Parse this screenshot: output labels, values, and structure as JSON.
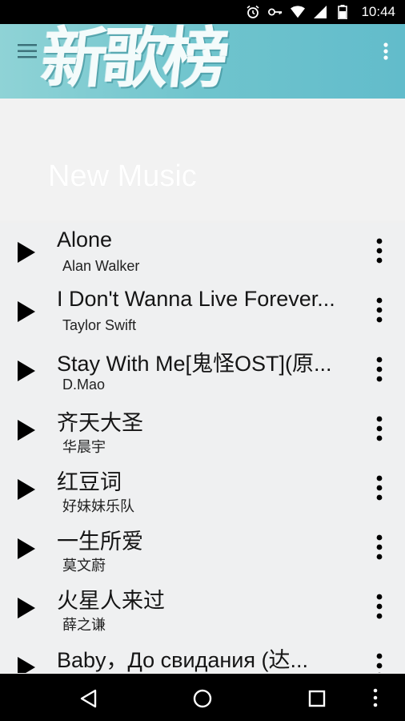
{
  "status_bar": {
    "time": "10:44",
    "icons": [
      "alarm-icon",
      "key-icon",
      "wifi-icon",
      "signal-icon",
      "battery-icon"
    ]
  },
  "header": {
    "banner_text": "新歌榜",
    "menu_icon": "hamburger-menu-icon",
    "overflow_icon": "more-vert-icon",
    "colors": {
      "banner_start": "#8fd3d6",
      "banner_end": "#62bccb"
    }
  },
  "hero": {
    "title": "New Music"
  },
  "songs": [
    {
      "title": "Alone",
      "artist": "Alan Walker"
    },
    {
      "title": "I Don't Wanna Live Forever...",
      "artist": "Taylor Swift"
    },
    {
      "title": "Stay With Me[鬼怪OST](原...",
      "artist": "D.Mao"
    },
    {
      "title": "齐天大圣",
      "artist": "华晨宇"
    },
    {
      "title": "红豆词",
      "artist": "好妹妹乐队"
    },
    {
      "title": "一生所爱",
      "artist": "莫文蔚"
    },
    {
      "title": "火星人来过",
      "artist": "薛之谦"
    },
    {
      "title": "Baby，До свидания (达...",
      "artist": ""
    }
  ],
  "nav_bar": {
    "icons": [
      "back-icon",
      "home-icon",
      "recents-icon",
      "nav-more-icon"
    ]
  }
}
